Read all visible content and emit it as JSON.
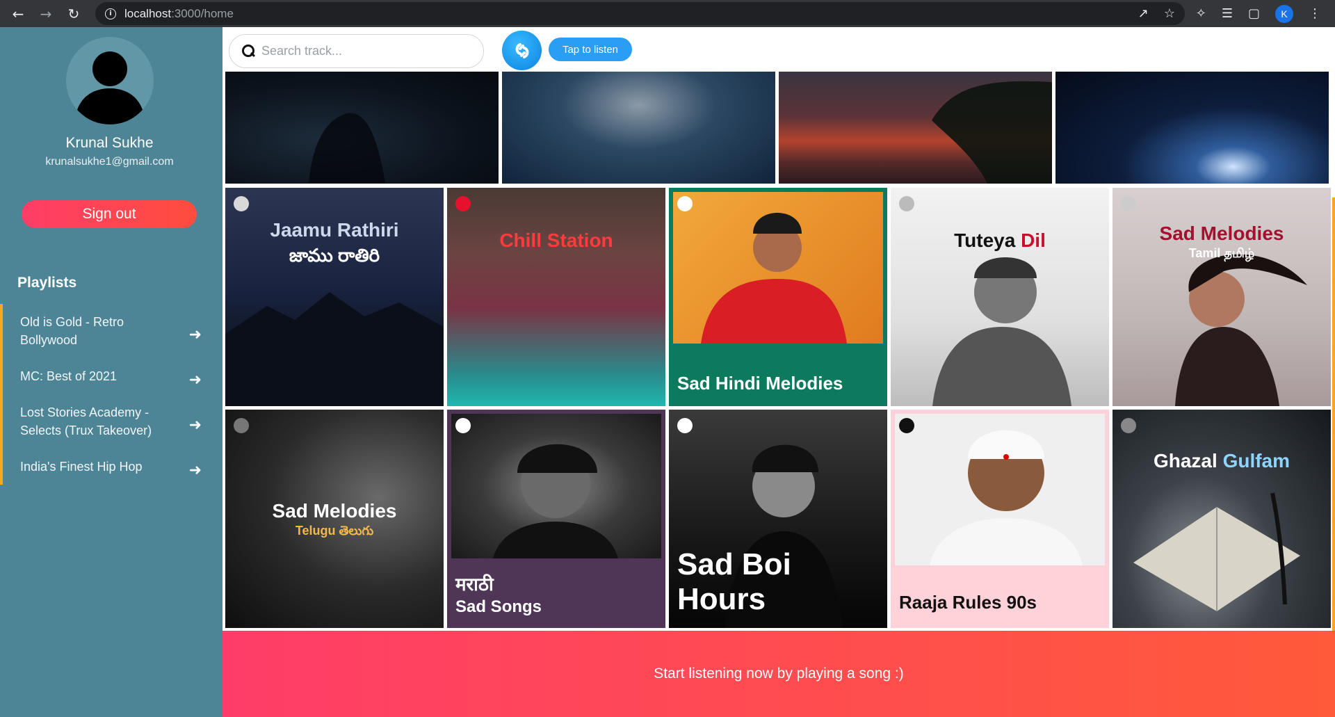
{
  "browser": {
    "url_host": "localhost",
    "url_path": ":3000/home",
    "profile_initial": "K"
  },
  "sidebar": {
    "user_name": "Krunal Sukhe",
    "user_email": "krunalsukhe1@gmail.com",
    "signout_label": "Sign out",
    "playlists_title": "Playlists",
    "items": [
      {
        "label": "Old is Gold - Retro Bollywood"
      },
      {
        "label": "MC: Best of 2021"
      },
      {
        "label": "Lost Stories Academy - Selects (Trux Takeover)"
      },
      {
        "label": "India's Finest Hip Hop"
      }
    ]
  },
  "topbar": {
    "search_placeholder": "Search track...",
    "tap_label": "Tap to listen"
  },
  "cards": [
    {
      "title": "Jaamu Rathiri",
      "subtitle": "జాము రాతిరి"
    },
    {
      "title": "Chill Station"
    },
    {
      "title": "Sad Hindi Melodies"
    },
    {
      "title_a": "Tuteya",
      "title_b": "Dil"
    },
    {
      "title": "Sad Melodies",
      "subtitle": "Tamil தமிழ்"
    },
    {
      "title": "Sad Melodies",
      "subtitle": "Telugu తెలుగు"
    },
    {
      "title": "मराठी",
      "subtitle": "Sad Songs"
    },
    {
      "title": "Sad Boi",
      "subtitle": "Hours"
    },
    {
      "title": "Raaja Rules 90s"
    },
    {
      "title_a": "Ghazal",
      "title_b": "Gulfam"
    }
  ],
  "player": {
    "message": "Start listening now by playing a song :)"
  },
  "colors": {
    "sidebar": "#4e8596",
    "accent_gradient_start": "#ff3d68",
    "accent_gradient_end": "#ff5a3a",
    "tap_button": "#2a9df4",
    "playlist_marker": "#f5a623"
  }
}
